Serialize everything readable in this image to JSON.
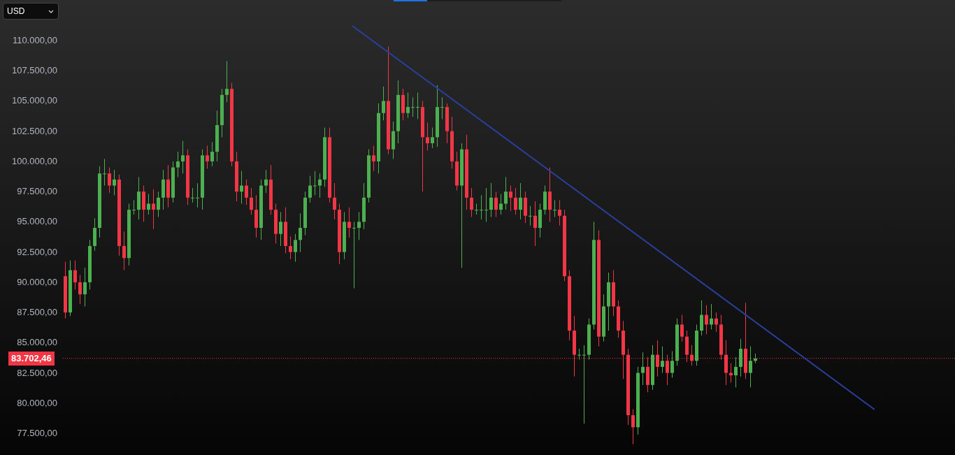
{
  "currency_select": {
    "value": "USD"
  },
  "loading_bar": {
    "level": 0.2
  },
  "current_price": "83.702,46",
  "chart_data": {
    "type": "candlestick",
    "ylim": [
      77500,
      110000
    ],
    "categories": [
      null,
      null,
      null,
      null,
      null,
      null,
      null,
      null,
      null,
      null,
      null,
      null,
      null,
      null,
      null,
      null,
      null,
      null,
      null,
      null,
      null,
      null,
      null,
      null,
      null,
      null,
      null,
      null,
      null,
      null,
      null,
      null,
      null,
      null,
      null,
      null,
      null,
      null,
      null,
      null,
      null,
      null,
      null,
      null,
      null,
      null,
      null,
      null,
      null,
      null,
      null,
      null,
      null,
      null,
      null,
      null,
      null,
      null,
      null,
      null,
      null,
      null,
      null,
      null,
      null,
      null,
      null,
      null,
      null,
      null,
      null,
      null,
      null,
      null,
      null,
      null,
      null,
      null,
      null,
      null,
      null,
      null,
      null,
      null,
      null,
      null,
      null,
      null,
      null,
      null,
      null,
      null,
      null,
      null,
      null,
      null,
      null,
      null,
      null,
      null,
      null,
      null,
      null,
      null,
      null,
      null,
      null,
      null,
      null,
      null,
      null,
      null,
      null,
      null,
      null,
      null,
      null,
      null,
      null,
      null,
      null,
      null,
      null,
      null,
      null,
      null,
      null,
      null,
      null,
      null,
      null,
      null,
      null,
      null,
      null,
      null,
      null,
      null,
      null,
      null,
      null,
      null
    ],
    "yticks": [
      {
        "value": 110000,
        "label": "110.000,00"
      },
      {
        "value": 107500,
        "label": "107.500,00"
      },
      {
        "value": 105000,
        "label": "105.000,00"
      },
      {
        "value": 102500,
        "label": "102.500,00"
      },
      {
        "value": 100000,
        "label": "100.000,00"
      },
      {
        "value": 97500,
        "label": "97.500,00"
      },
      {
        "value": 95000,
        "label": "95.000,00"
      },
      {
        "value": 92500,
        "label": "92.500,00"
      },
      {
        "value": 90000,
        "label": "90.000,00"
      },
      {
        "value": 87500,
        "label": "87.500,00"
      },
      {
        "value": 85000,
        "label": "85.000,00"
      },
      {
        "value": 82500,
        "label": "82.500,00"
      },
      {
        "value": 80000,
        "label": "80.000,00"
      },
      {
        "value": 77500,
        "label": "77.500,00"
      }
    ],
    "ohlc": [
      [
        90500,
        91700,
        87000,
        87500
      ],
      [
        87500,
        91800,
        87200,
        91000
      ],
      [
        91000,
        91800,
        89400,
        90000
      ],
      [
        90000,
        90600,
        88200,
        89000
      ],
      [
        89000,
        91200,
        88000,
        90000
      ],
      [
        90000,
        93500,
        89400,
        93000
      ],
      [
        93000,
        95300,
        92600,
        94500
      ],
      [
        94500,
        99600,
        93700,
        99000
      ],
      [
        99000,
        100200,
        98000,
        99000
      ],
      [
        99000,
        99500,
        97400,
        98000
      ],
      [
        98000,
        99300,
        97200,
        98500
      ],
      [
        98500,
        98900,
        92200,
        93000
      ],
      [
        93000,
        94200,
        91000,
        92000
      ],
      [
        92000,
        96500,
        91400,
        96000
      ],
      [
        96000,
        96800,
        95600,
        96000
      ],
      [
        96000,
        98700,
        95200,
        97500
      ],
      [
        97500,
        98000,
        95000,
        96000
      ],
      [
        96000,
        97300,
        95600,
        96500
      ],
      [
        96500,
        97700,
        94400,
        96000
      ],
      [
        96000,
        97500,
        95400,
        97000
      ],
      [
        97000,
        99300,
        96000,
        98500
      ],
      [
        98500,
        99700,
        96200,
        97000
      ],
      [
        97000,
        100000,
        96600,
        99500
      ],
      [
        99500,
        100800,
        98700,
        100000
      ],
      [
        100000,
        101700,
        99000,
        100500
      ],
      [
        100500,
        101000,
        96400,
        97000
      ],
      [
        97000,
        97800,
        96600,
        97000
      ],
      [
        97000,
        98200,
        96200,
        97000
      ],
      [
        97000,
        101000,
        96000,
        100500
      ],
      [
        100500,
        101300,
        99400,
        100000
      ],
      [
        100000,
        101600,
        99600,
        100800
      ],
      [
        100800,
        104200,
        100000,
        103000
      ],
      [
        103000,
        106000,
        102000,
        105500
      ],
      [
        105500,
        108300,
        104900,
        106000
      ],
      [
        106000,
        106500,
        99600,
        100000
      ],
      [
        100000,
        100800,
        96700,
        97500
      ],
      [
        97500,
        99200,
        96500,
        98000
      ],
      [
        98000,
        98500,
        96400,
        97000
      ],
      [
        97000,
        97800,
        95600,
        96000
      ],
      [
        96000,
        97200,
        93700,
        94500
      ],
      [
        94500,
        98500,
        93500,
        98000
      ],
      [
        98000,
        99300,
        97400,
        98500
      ],
      [
        98500,
        99700,
        95600,
        96000
      ],
      [
        96000,
        96500,
        93200,
        94000
      ],
      [
        94000,
        95800,
        93000,
        95000
      ],
      [
        95000,
        96200,
        92400,
        93000
      ],
      [
        93000,
        93800,
        91900,
        92500
      ],
      [
        92500,
        94000,
        91700,
        93500
      ],
      [
        93500,
        95700,
        92500,
        94500
      ],
      [
        94500,
        97500,
        93900,
        97000
      ],
      [
        97000,
        98800,
        96600,
        98000
      ],
      [
        98000,
        99200,
        97200,
        98000
      ],
      [
        98000,
        99000,
        97000,
        98500
      ],
      [
        98500,
        102800,
        97900,
        102000
      ],
      [
        102000,
        102800,
        96600,
        97000
      ],
      [
        97000,
        98200,
        95200,
        96000
      ],
      [
        96000,
        96500,
        91500,
        92500
      ],
      [
        92500,
        95800,
        91900,
        95000
      ],
      [
        95000,
        96200,
        93700,
        94500
      ],
      [
        94500,
        95000,
        89500,
        94500
      ],
      [
        94500,
        95800,
        93500,
        95000
      ],
      [
        95000,
        98200,
        94400,
        97000
      ],
      [
        97000,
        101000,
        96600,
        100500
      ],
      [
        100500,
        101300,
        99200,
        100000
      ],
      [
        100000,
        104800,
        99000,
        104000
      ],
      [
        104000,
        106200,
        103400,
        105000
      ],
      [
        105000,
        109500,
        100600,
        101000
      ],
      [
        101000,
        103300,
        100200,
        102500
      ],
      [
        102500,
        106700,
        101500,
        105500
      ],
      [
        105500,
        106000,
        103400,
        104000
      ],
      [
        104000,
        105700,
        103600,
        104500
      ],
      [
        104500,
        105300,
        103700,
        104500
      ],
      [
        104500,
        105700,
        103500,
        104500
      ],
      [
        104500,
        105000,
        97500,
        102000
      ],
      [
        102000,
        103200,
        100900,
        101500
      ],
      [
        101500,
        102800,
        101100,
        102000
      ],
      [
        102000,
        106300,
        101200,
        104500
      ],
      [
        104500,
        105300,
        103500,
        104500
      ],
      [
        104500,
        104800,
        101500,
        102500
      ],
      [
        102500,
        103700,
        99400,
        100000
      ],
      [
        100000,
        100800,
        97600,
        98000
      ],
      [
        98000,
        101500,
        91200,
        101000
      ],
      [
        101000,
        102200,
        96000,
        97000
      ],
      [
        97000,
        97800,
        95400,
        96000
      ],
      [
        96000,
        96500,
        95600,
        96000
      ],
      [
        96000,
        97200,
        95200,
        96000
      ],
      [
        96000,
        97800,
        95000,
        96000
      ],
      [
        96000,
        98200,
        95400,
        97000
      ],
      [
        97000,
        97500,
        95400,
        96000
      ],
      [
        96000,
        97300,
        95600,
        96500
      ],
      [
        96500,
        98700,
        96000,
        97500
      ],
      [
        97500,
        98000,
        95900,
        97000
      ],
      [
        97000,
        97800,
        95600,
        96000
      ],
      [
        96000,
        98200,
        95200,
        97000
      ],
      [
        97000,
        97500,
        94900,
        95500
      ],
      [
        95500,
        96300,
        94700,
        95500
      ],
      [
        95500,
        96700,
        93000,
        94500
      ],
      [
        94500,
        96500,
        93700,
        96000
      ],
      [
        96000,
        98000,
        95600,
        97500
      ],
      [
        97500,
        99500,
        95000,
        96000
      ],
      [
        96000,
        96800,
        95400,
        96000
      ],
      [
        96000,
        96800,
        94700,
        95500
      ],
      [
        95500,
        96000,
        90100,
        90500
      ],
      [
        90500,
        91000,
        85200,
        86000
      ],
      [
        86000,
        87200,
        82200,
        84000
      ],
      [
        84000,
        84500,
        83600,
        84000
      ],
      [
        84000,
        84800,
        78300,
        84000
      ],
      [
        84000,
        87000,
        83600,
        86500
      ],
      [
        86500,
        95000,
        86100,
        93500
      ],
      [
        93500,
        94300,
        84700,
        85500
      ],
      [
        85500,
        89000,
        85100,
        88000
      ],
      [
        88000,
        90800,
        86000,
        90000
      ],
      [
        90000,
        91000,
        87200,
        88000
      ],
      [
        88000,
        88500,
        85400,
        86000
      ],
      [
        86000,
        86800,
        82000,
        84000
      ],
      [
        84000,
        84500,
        78200,
        79000
      ],
      [
        79000,
        79500,
        76600,
        78000
      ],
      [
        78000,
        83000,
        77400,
        82500
      ],
      [
        82500,
        84200,
        81500,
        83000
      ],
      [
        83000,
        83800,
        80900,
        81500
      ],
      [
        81500,
        84800,
        81100,
        84000
      ],
      [
        84000,
        85200,
        82200,
        83000
      ],
      [
        83000,
        84700,
        82500,
        83500
      ],
      [
        83500,
        84000,
        81500,
        82500
      ],
      [
        82500,
        84300,
        82100,
        83500
      ],
      [
        83500,
        87000,
        83100,
        86500
      ],
      [
        86500,
        87300,
        85100,
        85500
      ],
      [
        85500,
        86000,
        83400,
        84000
      ],
      [
        84000,
        84800,
        83100,
        83500
      ],
      [
        83500,
        86500,
        83100,
        86000
      ],
      [
        86000,
        88500,
        85600,
        87300
      ],
      [
        87300,
        88100,
        85700,
        86500
      ],
      [
        86500,
        88200,
        86100,
        87000
      ],
      [
        87000,
        87500,
        85900,
        86500
      ],
      [
        86500,
        87300,
        83600,
        84000
      ],
      [
        84000,
        85200,
        81500,
        82500
      ],
      [
        82500,
        83300,
        81700,
        82300
      ],
      [
        82300,
        83800,
        81300,
        83000
      ],
      [
        83000,
        85300,
        82200,
        84500
      ],
      [
        84500,
        88300,
        82000,
        82500
      ],
      [
        82500,
        84700,
        81300,
        83500
      ],
      [
        83500,
        84100,
        83300,
        83700
      ]
    ]
  }
}
